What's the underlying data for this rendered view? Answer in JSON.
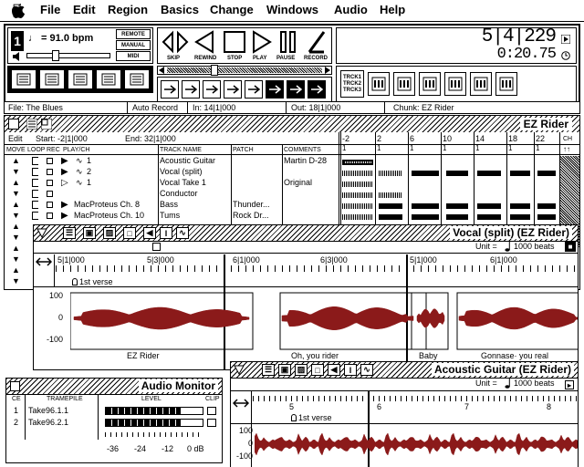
{
  "menubar": {
    "items": [
      "File",
      "Edit",
      "Region",
      "Basics",
      "Change",
      "Windows",
      "Audio",
      "Help"
    ]
  },
  "transport": {
    "tempo": "♩ = 91.0 bpm",
    "remote": "REMOTE",
    "manual": "MANUAL",
    "midi": "MIDI",
    "labels": [
      "SKIP",
      "REWIND",
      "STOP",
      "PLAY",
      "PAUSE",
      "RECORD"
    ],
    "counter": "5|4|229",
    "time": "0:20.75",
    "tracks_btn": [
      "TRCK1",
      "TRCK2",
      "TRCK3"
    ]
  },
  "status": {
    "file": "File: The Blues",
    "auto": "Auto Record",
    "in": "In: 14|1|000",
    "out": "Out: 18|1|000",
    "chunk": "Chunk: EZ Rider"
  },
  "ez_window": {
    "title": "EZ Rider",
    "edit": "Edit",
    "start": "Start: -2|1|000",
    "end": "End: 32|1|000",
    "headers": {
      "move": "MOVE",
      "loop": "LOOP",
      "rec": "REC",
      "play": "PLAY/CH",
      "track": "TRACK NAME",
      "patch": "PATCH",
      "comments": "COMMENTS",
      "ch": "CH"
    },
    "measures": [
      "-2",
      "2",
      "6",
      "10",
      "14",
      "18",
      "22"
    ],
    "rows": [
      {
        "ch": "1",
        "name": "Acoustic Guitar",
        "patch": "",
        "comment": "Martin D-28"
      },
      {
        "ch": "2",
        "name": "Vocal (split)",
        "patch": "",
        "comment": ""
      },
      {
        "ch": "1",
        "name": "Vocal Take 1",
        "patch": "",
        "comment": "Original"
      },
      {
        "ch": "",
        "name": "Conductor",
        "patch": "",
        "comment": ""
      },
      {
        "ch": "MacProteus Ch. 8",
        "name": "Bass",
        "patch": "Thunder...",
        "comment": ""
      },
      {
        "ch": "MacProteus Ch. 10",
        "name": "Tums",
        "patch": "Rock Dr...",
        "comment": ""
      }
    ]
  },
  "vocal_window": {
    "title": "Vocal (split) (EZ Rider)",
    "unit_label": "Unit =",
    "unit_value": "1000 beats",
    "ruler": [
      "5|1|000",
      "5|3|000",
      "6|1|000",
      "6|3|000",
      "5|1|000",
      "6|1|000"
    ],
    "marker": "1st verse",
    "yticks": [
      "100",
      "0",
      "-100"
    ],
    "clips": [
      "EZ Rider",
      "Oh, you rider",
      "Baby",
      "Gonnase· you real"
    ]
  },
  "audio_monitor": {
    "title": "Audio Monitor",
    "headers": {
      "ce": "CE",
      "file": "TRAMEPILE",
      "level": "LEVEL",
      "clip": "CLIP"
    },
    "rows": [
      {
        "n": "1",
        "file": "Take96.1.1"
      },
      {
        "n": "2",
        "file": "Take96.2.1"
      }
    ],
    "scale": [
      "-36",
      "-24",
      "-12",
      "0 dB"
    ]
  },
  "guitar_window": {
    "title": "Acoustic Guitar (EZ Rider)",
    "unit_label": "Unit =",
    "unit_value": "1000 beats",
    "ruler": [
      "5",
      "6",
      "7",
      "8"
    ],
    "marker": "1st verse",
    "yticks": [
      "100",
      "0",
      "-100"
    ]
  }
}
